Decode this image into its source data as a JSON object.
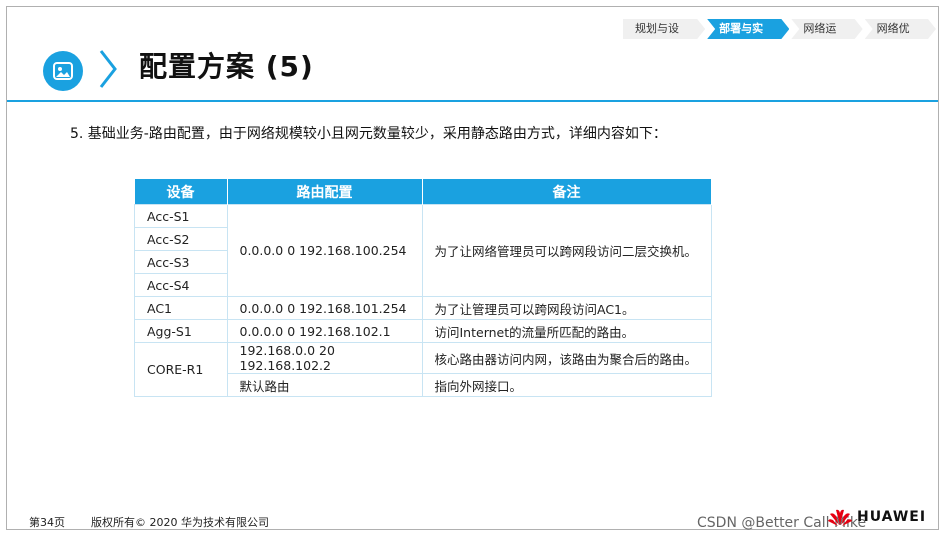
{
  "nav": {
    "steps": [
      "规划与设计",
      "部署与实施",
      "网络运维",
      "网络优化"
    ]
  },
  "header": {
    "title": "配置方案 (5)"
  },
  "intro": "5. 基础业务-路由配置，由于网络规模较小且网元数量较少，采用静态路由方式，详细内容如下：",
  "table": {
    "headers": [
      "设备",
      "路由配置",
      "备注"
    ],
    "access_devices": [
      "Acc-S1",
      "Acc-S2",
      "Acc-S3",
      "Acc-S4"
    ],
    "access_route": "0.0.0.0 0 192.168.100.254",
    "access_note": "为了让网络管理员可以跨网段访问二层交换机。",
    "ac1": {
      "device": "AC1",
      "route": "0.0.0.0 0 192.168.101.254",
      "note": "为了让管理员可以跨网段访问AC1。"
    },
    "agg": {
      "device": "Agg-S1",
      "route": "0.0.0.0 0 192.168.102.1",
      "note": "访问Internet的流量所匹配的路由。"
    },
    "core": {
      "device": "CORE-R1",
      "route1": "192.168.0.0 20 192.168.102.2",
      "note1": "核心路由器访问内网，该路由为聚合后的路由。",
      "route2": "默认路由",
      "note2": "指向外网接口。"
    }
  },
  "footer": {
    "page": "第34页",
    "copyright": "版权所有© 2020 华为技术有限公司",
    "brand": "HUAWEI",
    "watermark": "CSDN @Better Call Mike"
  },
  "colors": {
    "accent": "#1aa1e0",
    "huawei_red": "#e60012"
  }
}
